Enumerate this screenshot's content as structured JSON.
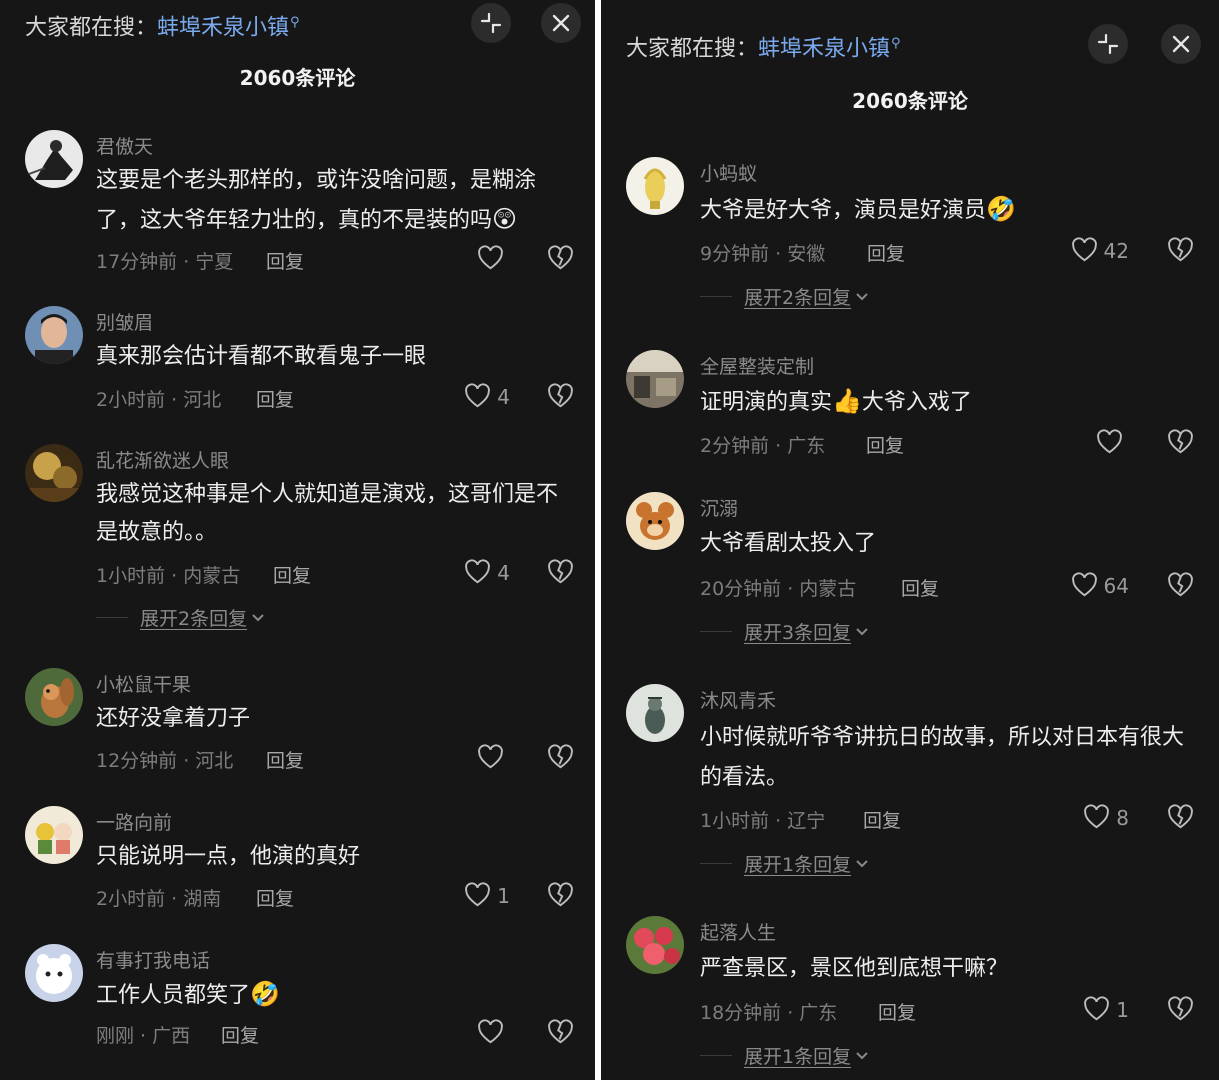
{
  "left": {
    "search_hint": {
      "prefix": "大家都在搜：",
      "term": "蚌埠禾泉小镇"
    },
    "comments_count": "2060条评论",
    "comments": [
      {
        "user": "君傲天",
        "text": "这要是个老头那样的，或许没啥问题，是糊涂了，这大爷年轻力壮的，真的不是装的吗",
        "emoji": "😲",
        "time_location": "17分钟前 · 宁夏",
        "reply": "回复",
        "likes": ""
      },
      {
        "user": "别皱眉",
        "text": "真来那会估计看都不敢看鬼子一眼",
        "emoji": "",
        "time_location": "2小时前 · 河北",
        "reply": "回复",
        "likes": "4"
      },
      {
        "user": "乱花渐欲迷人眼",
        "text": "我感觉这种事是个人就知道是演戏，这哥们是不是故意的。。",
        "emoji": "",
        "time_location": "1小时前 · 内蒙古",
        "reply": "回复",
        "likes": "4",
        "expand": "展开2条回复"
      },
      {
        "user": "小松鼠干果",
        "text": "还好没拿着刀子",
        "emoji": "",
        "time_location": "12分钟前 · 河北",
        "reply": "回复",
        "likes": ""
      },
      {
        "user": "一路向前",
        "text": "只能说明一点，他演的真好",
        "emoji": "",
        "time_location": "2小时前 · 湖南",
        "reply": "回复",
        "likes": "1"
      },
      {
        "user": "有事打我电话",
        "text": "工作人员都笑了",
        "emoji": "🤣",
        "time_location": "刚刚 · 广西",
        "reply": "回复",
        "likes": ""
      }
    ]
  },
  "right": {
    "search_hint": {
      "prefix": "大家都在搜：",
      "term": "蚌埠禾泉小镇"
    },
    "comments_count": "2060条评论",
    "comments": [
      {
        "user": "小蚂蚁",
        "text": "大爷是好大爷，演员是好演员",
        "emoji": "🤣",
        "time_location": "9分钟前 · 安徽",
        "reply": "回复",
        "likes": "42",
        "expand": "展开2条回复"
      },
      {
        "user": "全屋整装定制",
        "text": "证明演的真实",
        "emoji": "👍",
        "text2": "大爷入戏了",
        "time_location": "2分钟前 · 广东",
        "reply": "回复",
        "likes": ""
      },
      {
        "user": "沉溺",
        "text": "大爷看剧太投入了",
        "emoji": "",
        "time_location": "20分钟前 · 内蒙古",
        "reply": "回复",
        "likes": "64",
        "expand": "展开3条回复"
      },
      {
        "user": "沐风青禾",
        "text": "小时候就听爷爷讲抗日的故事，所以对日本有很大的看法。",
        "emoji": "",
        "time_location": "1小时前 · 辽宁",
        "reply": "回复",
        "likes": "8",
        "expand": "展开1条回复"
      },
      {
        "user": "起落人生",
        "text": "严查景区，景区他到底想干嘛？",
        "emoji": "",
        "time_location": "18分钟前 · 广东",
        "reply": "回复",
        "likes": "1",
        "expand": "展开1条回复"
      }
    ]
  },
  "colors": {
    "background": "#161616",
    "search_term": "#7aa9ee",
    "text_primary": "#ededed",
    "text_secondary": "#8a8a8a"
  },
  "icons": {
    "collapse": "minimize-arrows-icon",
    "close": "close-icon",
    "like": "heart-outline-icon",
    "dislike": "broken-heart-icon",
    "expand": "chevron-down-icon",
    "search_mark": "search-icon"
  }
}
